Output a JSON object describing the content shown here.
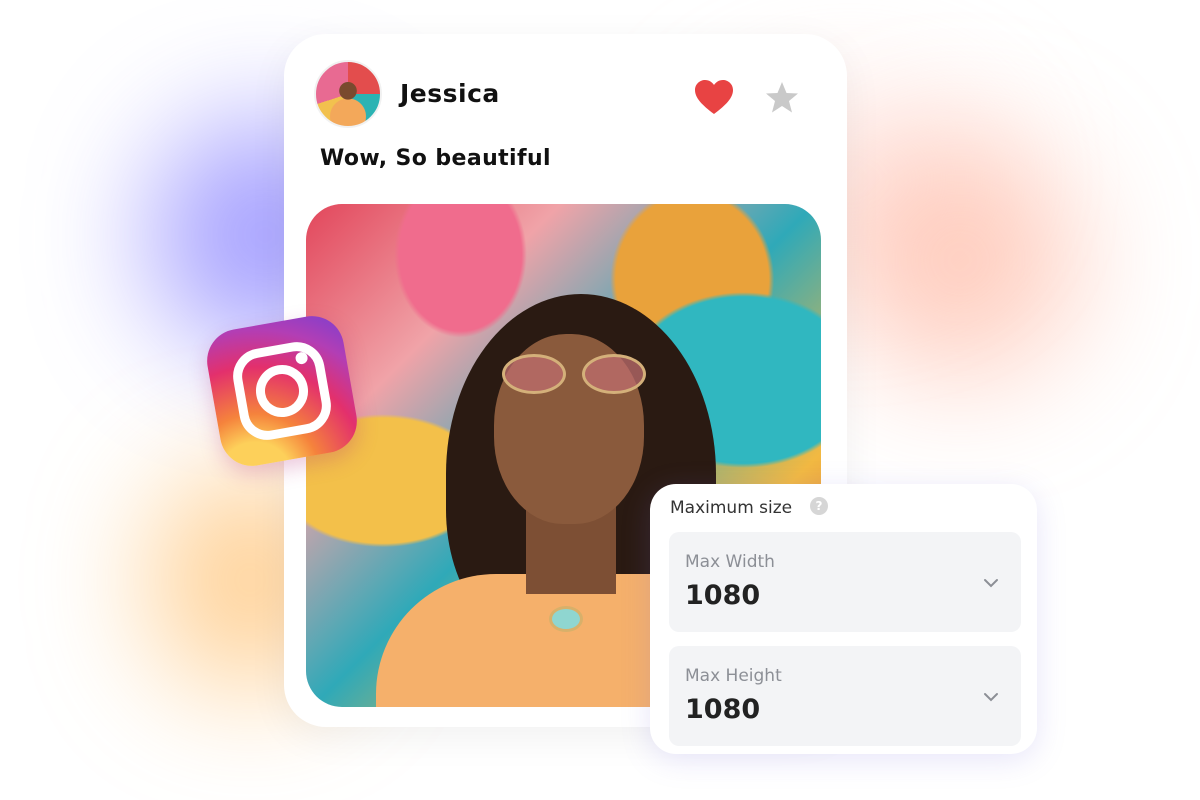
{
  "post": {
    "username": "Jessica",
    "caption": "Wow, So beautiful",
    "icons": {
      "avatar": "user-avatar",
      "like": "heart-icon",
      "favorite": "star-icon",
      "brand": "instagram-icon"
    },
    "colors": {
      "heart": "#e84343",
      "star": "#c9c9c9"
    }
  },
  "size_panel": {
    "title": "Maximum size",
    "help_icon": "?",
    "fields": [
      {
        "label": "Max Width",
        "value": "1080"
      },
      {
        "label": "Max Height",
        "value": "1080"
      }
    ]
  }
}
